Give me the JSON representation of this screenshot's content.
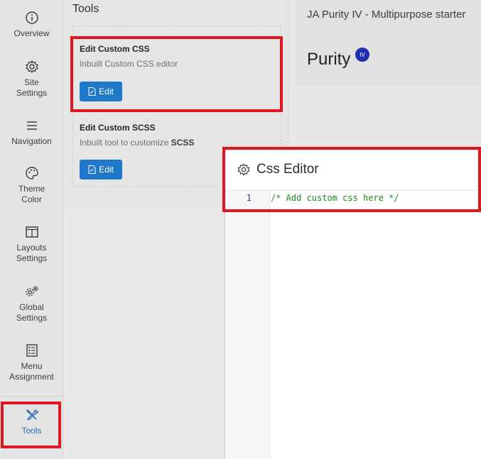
{
  "sidebar": {
    "items": [
      {
        "label_1": "Overview",
        "label_2": "",
        "icon": "info-icon"
      },
      {
        "label_1": "Site",
        "label_2": "Settings",
        "icon": "gear-icon"
      },
      {
        "label_1": "Navigation",
        "label_2": "",
        "icon": "menu-icon"
      },
      {
        "label_1": "Theme",
        "label_2": "Color",
        "icon": "palette-icon"
      },
      {
        "label_1": "Layouts",
        "label_2": "Settings",
        "icon": "layout-icon"
      },
      {
        "label_1": "Global",
        "label_2": "Settings",
        "icon": "gears-icon"
      },
      {
        "label_1": "Menu",
        "label_2": "Assignment",
        "icon": "list-icon"
      },
      {
        "label_1": "Tools",
        "label_2": "",
        "icon": "tools-icon"
      }
    ],
    "active": "Tools",
    "accent_color": "#2a6cb3"
  },
  "tools": {
    "title": "Tools",
    "custom_css": {
      "title": "Edit Custom CSS",
      "desc": "Inbuilt Custom CSS editor",
      "button": "Edit"
    },
    "custom_scss": {
      "title": "Edit Custom SCSS",
      "desc_prefix": "Inbuilt tool to customize ",
      "desc_bold": "SCSS",
      "button": "Edit"
    },
    "button_color": "#1f78c8"
  },
  "preview": {
    "tagline": "JA Purity IV - Multipurpose starter",
    "logo_text": "Purity",
    "logo_badge": "IV"
  },
  "editor": {
    "title": "Css Editor",
    "icon": "gear-icon",
    "lines": [
      {
        "number": "1",
        "code": "/* Add custom css here */"
      }
    ]
  },
  "highlight_color": "#e0171f"
}
